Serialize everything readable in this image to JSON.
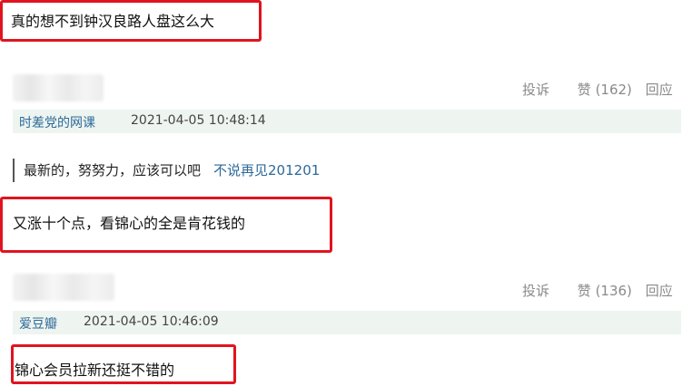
{
  "highlight_color": "#e0141e",
  "comments": [
    {
      "text": "真的想不到钟汉良路人盘这么大"
    },
    {
      "text": "又涨十个点，看锦心的全是肯花钱的",
      "actions": {
        "report": "投诉",
        "like": "赞 (162)",
        "reply": "回应"
      },
      "user": "时差党的网课",
      "time": "2021-04-05 10:48:14",
      "quote": {
        "text": "最新的，努努力，应该可以吧",
        "author": "不说再见201201"
      }
    },
    {
      "text": "锦心会员拉新还挺不错的",
      "actions": {
        "report": "投诉",
        "like": "赞 (136)",
        "reply": "回应"
      },
      "user": "爱豆瓣",
      "time": "2021-04-05 10:46:09"
    }
  ]
}
